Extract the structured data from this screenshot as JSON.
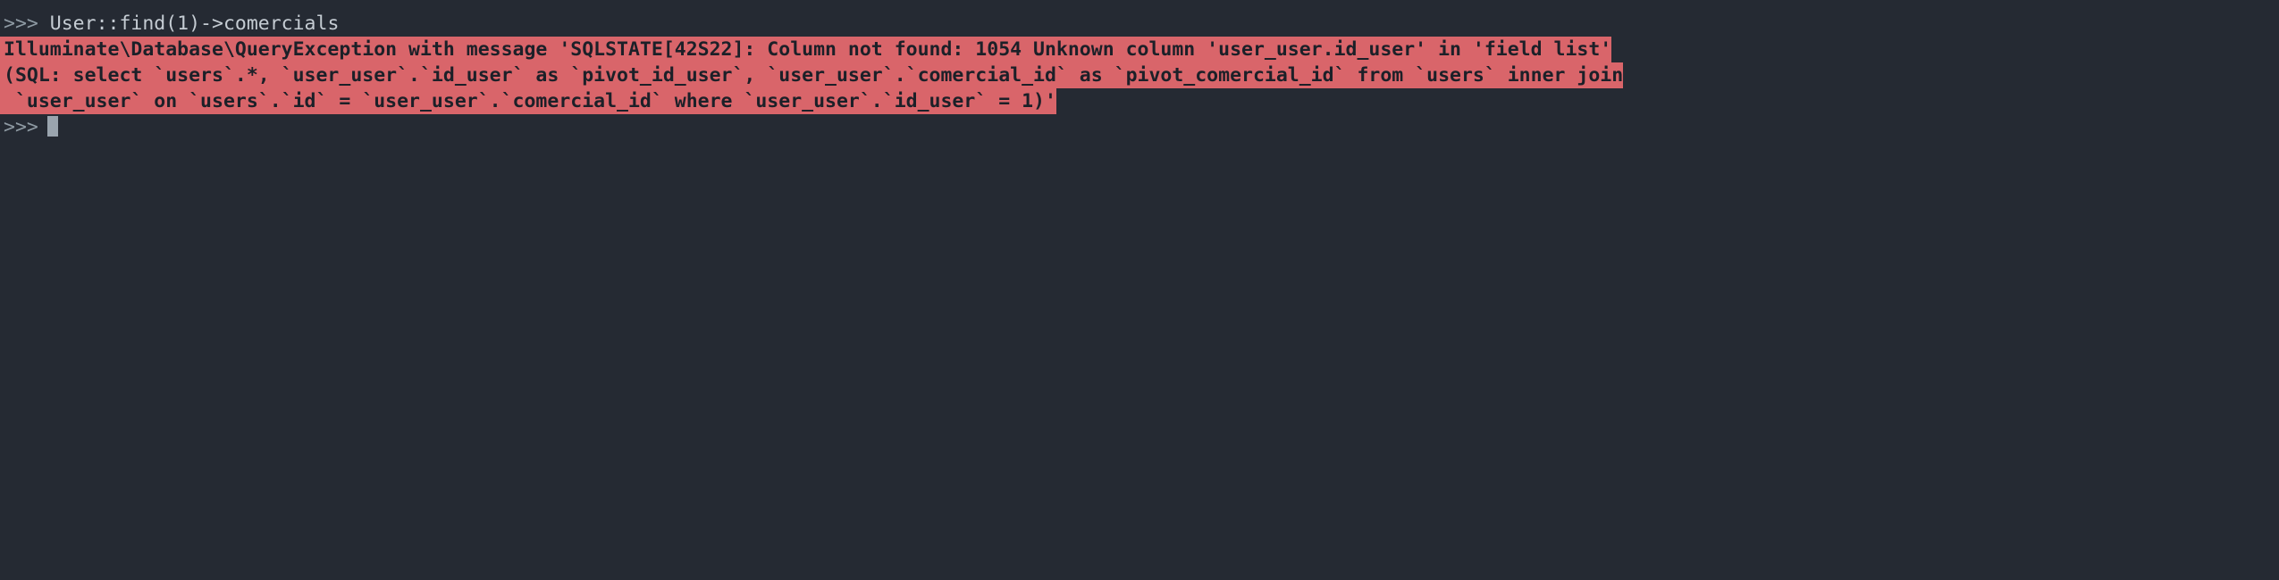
{
  "terminal": {
    "background_color": "#252a33",
    "prompt_color": "#8e9aa3",
    "text_color": "#c5ccd3",
    "error_background_color": "#d9656a",
    "error_text_color": "#1c2028",
    "prompt_symbol": ">>>",
    "lines": [
      {
        "type": "input",
        "prompt": ">>>",
        "command": " User::find(1)->comercials"
      },
      {
        "type": "error",
        "text": "Illuminate\\Database\\QueryException with message 'SQLSTATE[42S22]: Column not found: 1054 Unknown column 'user_user.id_user' in 'field list'"
      },
      {
        "type": "error",
        "text": "(SQL: select `users`.*, `user_user`.`id_user` as `pivot_id_user`, `user_user`.`comercial_id` as `pivot_comercial_id` from `users` inner join"
      },
      {
        "type": "error",
        "text": " `user_user` on `users`.`id` = `user_user`.`comercial_id` where `user_user`.`id_user` = 1)'"
      },
      {
        "type": "cursor",
        "prompt": ">>>"
      }
    ]
  }
}
